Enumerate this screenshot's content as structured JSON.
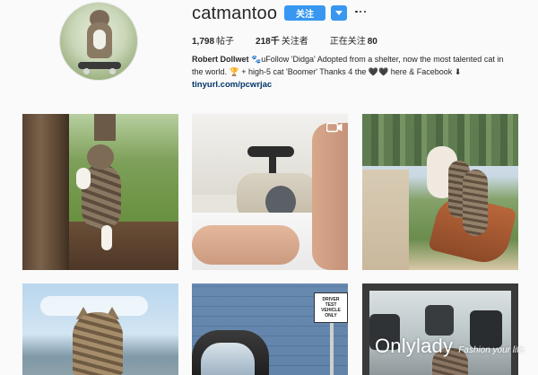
{
  "profile": {
    "username": "catmantoo",
    "follow_label": "关注",
    "stats": {
      "posts_count": "1,798",
      "posts_label": "帖子",
      "followers_count": "218千",
      "followers_label": "关注者",
      "following_label": "正在关注",
      "following_count": "80"
    },
    "bio": {
      "name": "Robert Dollwet",
      "line1": "🐾uFollow 'Didga' Adopted from a shelter, now the most talented cat in",
      "line2": "the world. 🏆 + high-5 cat 'Boomer' Thanks 4 the 🖤🖤 here & Facebook ⬇",
      "link": "tinyurl.com/pcwrjac"
    }
  },
  "posts": [
    {
      "id": "post-1",
      "icon": "none"
    },
    {
      "id": "post-2",
      "icon": "video-camera-icon"
    },
    {
      "id": "post-3",
      "icon": "none"
    },
    {
      "id": "post-4",
      "icon": "none"
    },
    {
      "id": "post-5",
      "icon": "none",
      "sign_text": [
        "DRIVER",
        "TEST",
        "VEHICLE",
        "ONLY"
      ]
    },
    {
      "id": "post-6",
      "icon": "none"
    }
  ],
  "watermark": {
    "brand": "Onlylady",
    "tagline": "Fashion your life"
  },
  "colors": {
    "accent": "#3897f0",
    "link": "#003569",
    "text": "#262626",
    "background": "#fafafa"
  }
}
